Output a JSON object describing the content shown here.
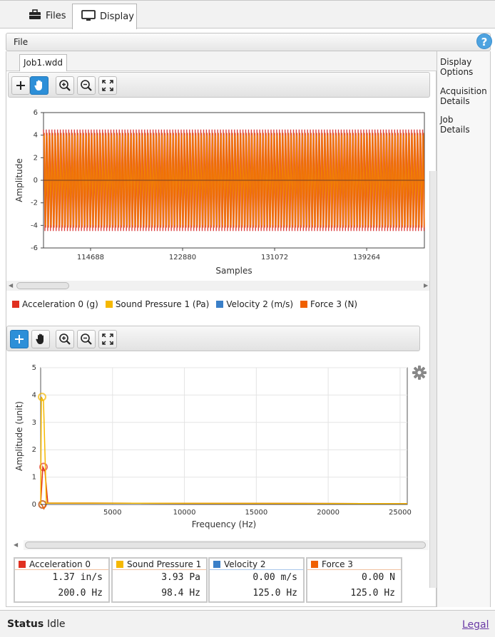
{
  "tabs": [
    {
      "label": "Files",
      "icon": "briefcase-icon"
    },
    {
      "label": "Display",
      "icon": "monitor-icon",
      "active": true
    }
  ],
  "filebar": {
    "menu_label": "File",
    "help_label": "?"
  },
  "document_tab": "Job1.wdd",
  "side_panel": {
    "items": [
      "Display Options",
      "Acquisition Details",
      "Job Details"
    ]
  },
  "legend": {
    "items": [
      {
        "label": "Acceleration 0 (g)",
        "color": "#e03020"
      },
      {
        "label": "Sound Pressure 1 (Pa)",
        "color": "#f5b800"
      },
      {
        "label": "Velocity 2 (m/s)",
        "color": "#3a7fc8"
      },
      {
        "label": "Force 3 (N)",
        "color": "#f06000"
      }
    ]
  },
  "cursor_boxes": [
    {
      "name": "Acceleration 0",
      "color": "#e03020",
      "value": "1.37 in/s",
      "freq": "200.0 Hz"
    },
    {
      "name": "Sound Pressure 1",
      "color": "#f5b800",
      "value": "3.93 Pa",
      "freq": "98.4 Hz"
    },
    {
      "name": "Velocity 2",
      "color": "#3a7fc8",
      "value": "0.00 m/s",
      "freq": "125.0 Hz"
    },
    {
      "name": "Force 3",
      "color": "#f06000",
      "value": "0.00 N",
      "freq": "125.0 Hz"
    }
  ],
  "status": {
    "label": "Status",
    "value": "Idle",
    "legal": "Legal"
  },
  "chart_data": [
    {
      "type": "line",
      "xlabel": "Samples",
      "ylabel": "Amplitude",
      "ylim": [
        -6,
        6
      ],
      "yticks": [
        6,
        4,
        2,
        0,
        -2,
        -4,
        -6
      ],
      "xticks": [
        114688,
        122880,
        131072,
        139264
      ],
      "xlim": [
        110500,
        144400
      ],
      "grid": false,
      "series": [
        {
          "name": "Acceleration 0 (g)",
          "color": "#d62a2a",
          "amplitude": 4.5
        },
        {
          "name": "Sound Pressure 1 (Pa)",
          "color": "#f5b800",
          "amplitude": 4.0
        },
        {
          "name": "Force 3 (N)",
          "color": "#f06000",
          "amplitude": 4.2
        }
      ],
      "oscillation_period_samples": 250
    },
    {
      "type": "line",
      "xlabel": "Frequency (Hz)",
      "ylabel": "Amplitude (unit)",
      "ylim": [
        0,
        5
      ],
      "yticks": [
        0,
        1,
        2,
        3,
        4,
        5
      ],
      "xlim": [
        0,
        25500
      ],
      "xticks": [
        5000,
        10000,
        15000,
        20000,
        25000
      ],
      "grid": true,
      "series": [
        {
          "name": "Sound Pressure 1",
          "color": "#f5b800",
          "peak": [
            98.4,
            3.93
          ]
        },
        {
          "name": "Acceleration 0",
          "color": "#e03020",
          "peak": [
            200,
            1.37
          ]
        },
        {
          "name": "Force 3",
          "color": "#f06000",
          "peak": [
            125,
            0.0
          ]
        },
        {
          "name": "Velocity 2",
          "color": "#3a7fc8",
          "peak": [
            125,
            0.0
          ]
        }
      ]
    }
  ]
}
